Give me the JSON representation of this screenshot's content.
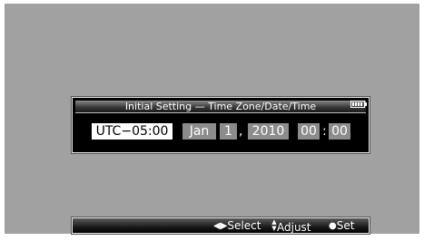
{
  "dialog": {
    "title": "Initial Setting — Time Zone/Date/Time",
    "battery_icon": "battery-full-icon",
    "time_zone": "UTC−05:00",
    "month": "Jan",
    "day": "1",
    "comma": ",",
    "year": "2010",
    "hour": "00",
    "colon": ":",
    "minute": "00"
  },
  "guide": {
    "select_icon": "left-right-arrows-icon",
    "select_glyph": "◀▶",
    "select_label": "Select",
    "adjust_icon": "up-down-arrows-icon",
    "adjust_glyph": "▲▼",
    "adjust_label": "Adjust",
    "set_icon": "dot-icon",
    "set_glyph": "●",
    "set_label": "Set"
  },
  "colors": {
    "background": "#a1a1a1",
    "dialog_bg": "#000000",
    "selected_field_bg": "#ffffff",
    "field_bg": "#8c8c8c"
  }
}
